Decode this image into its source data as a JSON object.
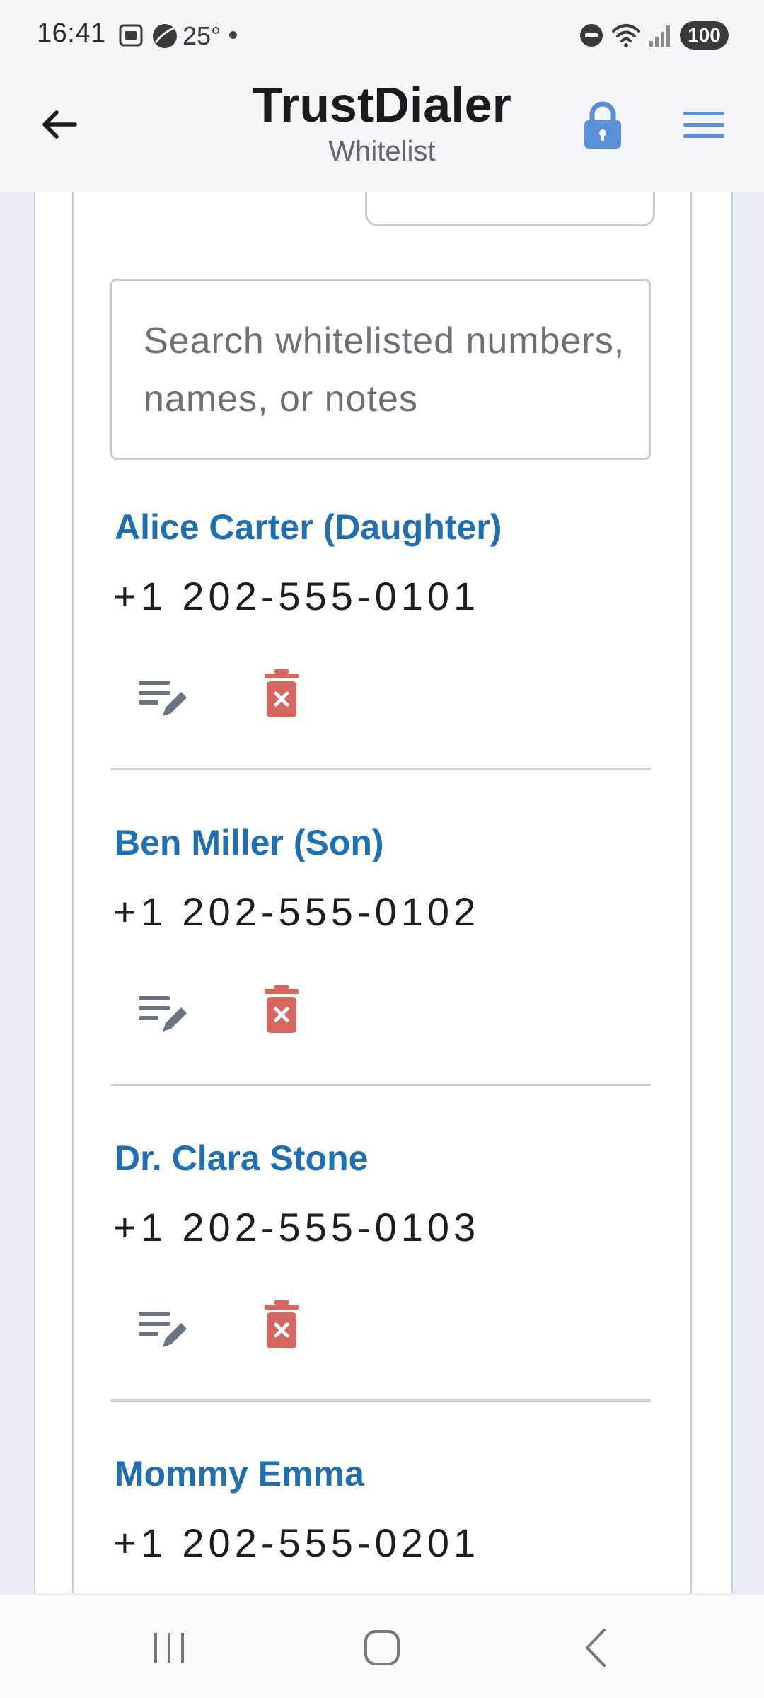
{
  "status_bar": {
    "time": "16:41",
    "temperature": "25°",
    "battery": "100"
  },
  "header": {
    "title": "TrustDialer",
    "subtitle": "Whitelist",
    "accent_color": "#5b8fd6"
  },
  "search": {
    "placeholder": "Search whitelisted numbers, names, or notes"
  },
  "contacts": [
    {
      "name": "Alice Carter (Daughter)",
      "number": "+1  202-555-0101"
    },
    {
      "name": "Ben Miller (Son)",
      "number": "+1  202-555-0102"
    },
    {
      "name": "Dr. Clara Stone",
      "number": "+1  202-555-0103"
    },
    {
      "name": "Mommy Emma",
      "number": "+1  202-555-0201"
    }
  ],
  "colors": {
    "name_color": "#1f6fb2",
    "delete_color": "#d5675f",
    "edit_color": "#6b7280"
  },
  "icons": {
    "back": "arrow-left-icon",
    "lock": "lock-icon",
    "menu": "hamburger-menu-icon",
    "edit": "edit-note-icon",
    "delete": "delete-icon"
  }
}
